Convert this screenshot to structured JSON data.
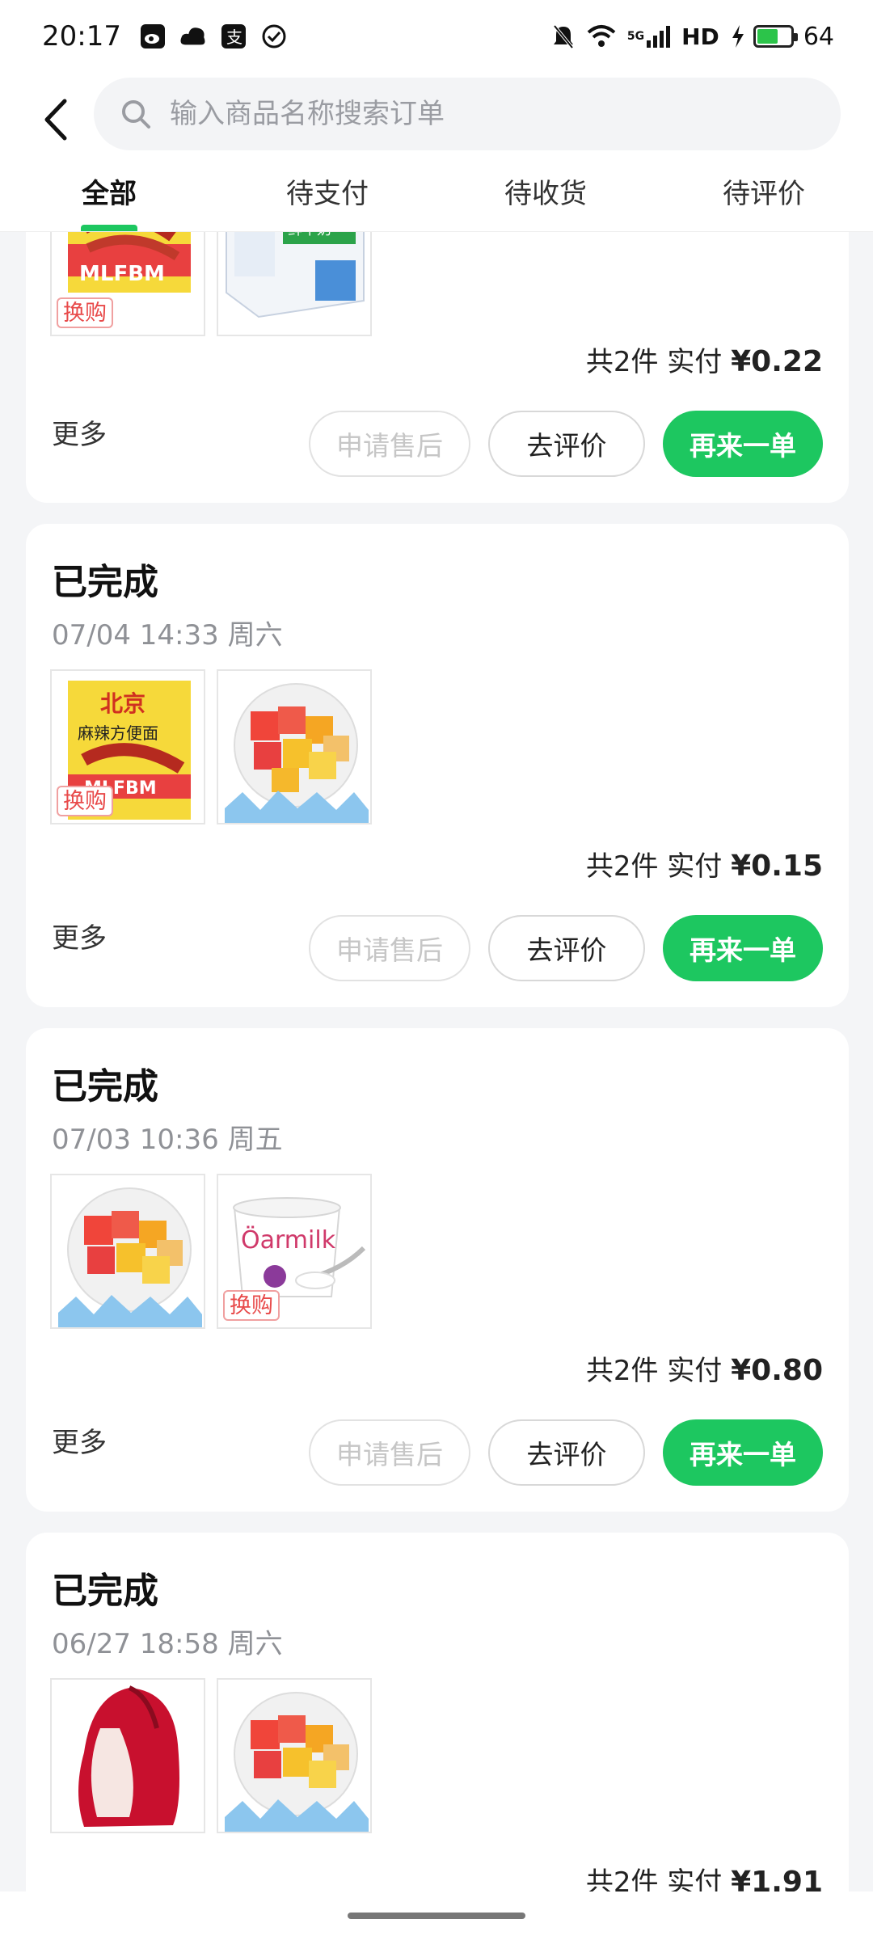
{
  "status_bar": {
    "time": "20:17",
    "network_label": "5G",
    "hd_label": "HD",
    "battery_percent": "64",
    "battery_level": 0.64,
    "left_app_icons": [
      "weibo-icon",
      "cloud-icon",
      "alipay-icon",
      "check-circle-icon"
    ],
    "right_icons": [
      "mute-bell-icon",
      "wifi-icon",
      "signal-icon",
      "charging-bolt-icon",
      "battery-icon"
    ]
  },
  "header": {
    "search_placeholder": "输入商品名称搜索订单",
    "tabs": [
      {
        "label": "全部",
        "active": true
      },
      {
        "label": "待支付",
        "active": false
      },
      {
        "label": "待收货",
        "active": false
      },
      {
        "label": "待评价",
        "active": false
      }
    ]
  },
  "colors": {
    "accent": "#1dc760",
    "background": "#f4f5f7",
    "swap_tag": "#e84a4a"
  },
  "common": {
    "more": "更多",
    "after_sale": "申请售后",
    "review": "去评价",
    "reorder": "再来一单",
    "swap_tag": "换购"
  },
  "orders": [
    {
      "status": "",
      "date": "",
      "items": [
        {
          "product": "noodles-pack",
          "swap": true
        },
        {
          "product": "milk-box",
          "swap": false
        }
      ],
      "summary_prefix": "共2件 实付",
      "amount": "¥0.22"
    },
    {
      "status": "已完成",
      "date": "07/04 14:33 周六",
      "items": [
        {
          "product": "noodles-pack",
          "swap": true
        },
        {
          "product": "fruit-cup",
          "swap": false
        }
      ],
      "summary_prefix": "共2件 实付",
      "amount": "¥0.15"
    },
    {
      "status": "已完成",
      "date": "07/03 10:36 周五",
      "items": [
        {
          "product": "fruit-cup",
          "swap": false
        },
        {
          "product": "yogurt-cup",
          "swap": true,
          "label": "Öarmilk"
        }
      ],
      "summary_prefix": "共2件 实付",
      "amount": "¥0.80"
    },
    {
      "status": "已完成",
      "date": "06/27 18:58 周六",
      "items": [
        {
          "product": "wax-apple",
          "swap": false
        },
        {
          "product": "fruit-cup",
          "swap": false
        }
      ],
      "summary_prefix": "共2件 实付",
      "amount": "¥1.91"
    }
  ]
}
